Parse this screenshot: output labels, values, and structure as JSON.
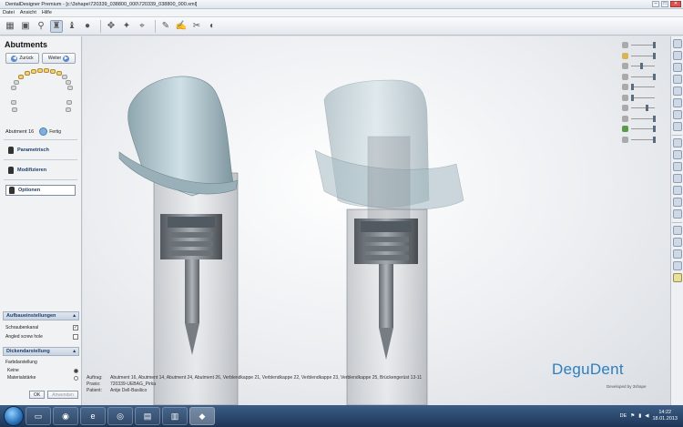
{
  "window": {
    "title": "DentalDesigner Premium - [c:\\3shape\\720339_038800_000\\720339_038800_000.xml]",
    "minimize": "–",
    "maximize": "□",
    "close": "✕"
  },
  "menu": [
    "Datei",
    "Ansicht",
    "Hilfe"
  ],
  "panel": {
    "title": "Abutments",
    "back_label": "Zurück",
    "next_label": "Weiter",
    "abutment_label": "Abutment 16",
    "done_label": "Fertig",
    "steps": [
      {
        "label": "Parametrisch",
        "selected": false
      },
      {
        "label": "Modifizieren",
        "selected": false
      },
      {
        "label": "Optionen",
        "selected": true
      }
    ]
  },
  "settings": {
    "section1": {
      "title": "Aufbaueinstellungen",
      "items": [
        {
          "label": "Schraubenkanal",
          "checked": true,
          "mark": "✓"
        },
        {
          "label": "Angled screw hole",
          "checked": false,
          "mark": ""
        }
      ]
    },
    "section2": {
      "title": "Dickendarstellung",
      "sub_label": "Farbdarstellung",
      "options": [
        {
          "label": "Keine",
          "selected": true
        },
        {
          "label": "Materialstärke",
          "selected": false
        }
      ]
    },
    "ok_label": "OK",
    "apply_label": "Anwenden"
  },
  "info": {
    "order_key": "Auftrag:",
    "order_value": "Abutment 16, Abutment 14, Abutment 24, Abutment 26, Verblendkappe 21, Verblendkappe 22, Verblendkappe 23, Verblendkappe 25, Brückengerüst 13-11",
    "practice_key": "Praxis:",
    "practice_value": "720339-UEBAG_Pirka",
    "patient_key": "Patient:",
    "patient_value": "Antje Dell-Basilico"
  },
  "brand": {
    "logo": "DeguDent",
    "sub": "Developed by 3shape",
    "color": "#2c7fbf"
  },
  "taskbar": {
    "lang": "DE",
    "time": "14:22",
    "date": "18.01.2013"
  }
}
